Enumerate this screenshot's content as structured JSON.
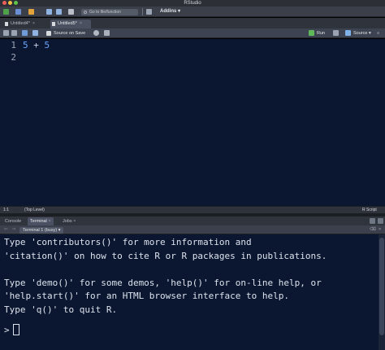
{
  "window": {
    "title": "RStudio"
  },
  "toolbar": {
    "goto_placeholder": "Go to file/function",
    "addins_label": "Addins"
  },
  "editor_tabs": [
    {
      "label": "Untitled4*",
      "close": "×"
    },
    {
      "label": "Untitled5*",
      "close": "×"
    }
  ],
  "editor_toolbar": {
    "source_on_save": "Source on Save",
    "run": "Run",
    "source": "Source"
  },
  "editor": {
    "line_numbers": [
      "1",
      "2"
    ],
    "code_lhs": "5",
    "code_op": "+",
    "code_rhs": "5"
  },
  "editor_status": {
    "position": "1:1",
    "scope": "(Top Level)",
    "file_type": "R Script"
  },
  "console_tabs": [
    {
      "label": "Console"
    },
    {
      "label": "Terminal"
    },
    {
      "label": "Jobs"
    }
  ],
  "terminal_toolbar": {
    "selector": "Terminal 1 (busy)"
  },
  "terminal": {
    "lines": [
      "Type 'contributors()' for more information and",
      "'citation()' on how to cite R or R packages in publications.",
      "",
      "Type 'demo()' for some demos, 'help()' for on-line help, or",
      "'help.start()' for an HTML browser interface to help.",
      "Type 'q()' to quit R."
    ],
    "prompt": ">"
  },
  "colors": {
    "editor_bg": "#0b1730",
    "traffic_close": "#ec5f58",
    "traffic_min": "#f2be3f",
    "traffic_max": "#5fc348",
    "code_number": "#6aa7ff"
  }
}
